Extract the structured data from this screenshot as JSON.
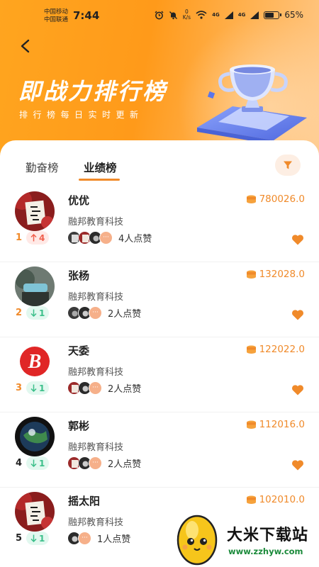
{
  "status_bar": {
    "carrier_1": "中国移动",
    "carrier_2": "中国联通",
    "time": "7:44",
    "speed_value": "0",
    "speed_unit": "K/s",
    "network_1": "4G",
    "network_2": "4G",
    "battery": "65%"
  },
  "header": {
    "title": "即战力排行榜",
    "subtitle": "排行榜每日实时更新"
  },
  "tabs": [
    {
      "label": "勤奋榜",
      "active": false
    },
    {
      "label": "业绩榜",
      "active": true
    }
  ],
  "list": [
    {
      "name": "优优",
      "score": "780026.0",
      "company": "融邦教育科技",
      "rank": "1",
      "trend": "up",
      "change": "4",
      "likes": "4人点赞"
    },
    {
      "name": "张杨",
      "score": "132028.0",
      "company": "融邦教育科技",
      "rank": "2",
      "trend": "down",
      "change": "1",
      "likes": "2人点赞"
    },
    {
      "name": "天委",
      "score": "122022.0",
      "company": "融邦教育科技",
      "rank": "3",
      "trend": "down",
      "change": "1",
      "likes": "2人点赞"
    },
    {
      "name": "郭彬",
      "score": "112016.0",
      "company": "融邦教育科技",
      "rank": "4",
      "trend": "down",
      "change": "1",
      "likes": "2人点赞"
    },
    {
      "name": "摇太阳",
      "score": "102010.0",
      "company": "融邦教育科技",
      "rank": "5",
      "trend": "down",
      "change": "1",
      "likes": "1人点赞"
    }
  ],
  "more_symbol": "···",
  "watermark": {
    "text": "大米下载站",
    "url": "www.zzhyw.com"
  },
  "colors": {
    "accent": "#f08a2a",
    "header_orange": "#ff9a1a",
    "rank_up": "#f0604d",
    "rank_down": "#3cbf8a"
  },
  "icons": {
    "back": "chevron-left-icon",
    "filter": "filter-funnel-icon",
    "coin": "coin-stack-icon",
    "heart": "heart-icon",
    "up": "arrow-up-icon",
    "down": "arrow-down-icon"
  }
}
